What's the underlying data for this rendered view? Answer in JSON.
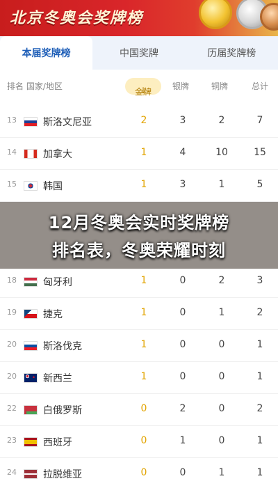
{
  "banner": {
    "title": "北京冬奥会奖牌榜"
  },
  "tabs": [
    {
      "label": "本届奖牌榜",
      "active": true
    },
    {
      "label": "中国奖牌",
      "active": false
    },
    {
      "label": "历届奖牌榜",
      "active": false
    }
  ],
  "header": {
    "rank_country": "排名 国家/地区",
    "gold": "金牌",
    "gold_sort_indicator": "↓",
    "silver": "银牌",
    "bronze": "铜牌",
    "total": "总计"
  },
  "rows": [
    {
      "rank": "13",
      "country": "斯洛文尼亚",
      "flag": "slovenia-flag",
      "gold": "2",
      "silver": "3",
      "bronze": "2",
      "total": "7"
    },
    {
      "rank": "14",
      "country": "加拿大",
      "flag": "canada-flag",
      "gold": "1",
      "silver": "4",
      "bronze": "10",
      "total": "15"
    },
    {
      "rank": "15",
      "country": "韩国",
      "flag": "korea-flag",
      "gold": "1",
      "silver": "3",
      "bronze": "1",
      "total": "5"
    },
    {
      "rank": "18",
      "country": "匈牙利",
      "flag": "hungary-flag",
      "gold": "1",
      "silver": "0",
      "bronze": "2",
      "total": "3"
    },
    {
      "rank": "19",
      "country": "捷克",
      "flag": "czech-flag",
      "gold": "1",
      "silver": "0",
      "bronze": "1",
      "total": "2"
    },
    {
      "rank": "20",
      "country": "斯洛伐克",
      "flag": "slovakia-flag",
      "gold": "1",
      "silver": "0",
      "bronze": "0",
      "total": "1"
    },
    {
      "rank": "20",
      "country": "新西兰",
      "flag": "new-zealand-flag",
      "gold": "1",
      "silver": "0",
      "bronze": "0",
      "total": "1"
    },
    {
      "rank": "22",
      "country": "白俄罗斯",
      "flag": "belarus-flag",
      "gold": "0",
      "silver": "2",
      "bronze": "0",
      "total": "2"
    },
    {
      "rank": "23",
      "country": "西班牙",
      "flag": "spain-flag",
      "gold": "0",
      "silver": "1",
      "bronze": "0",
      "total": "1"
    },
    {
      "rank": "24",
      "country": "拉脱维亚",
      "flag": "latvia-flag",
      "gold": "0",
      "silver": "0",
      "bronze": "1",
      "total": "1"
    }
  ],
  "overlay": {
    "line1": "12月冬奥会实时奖牌榜",
    "line2": "排名表，冬奥荣耀时刻"
  }
}
